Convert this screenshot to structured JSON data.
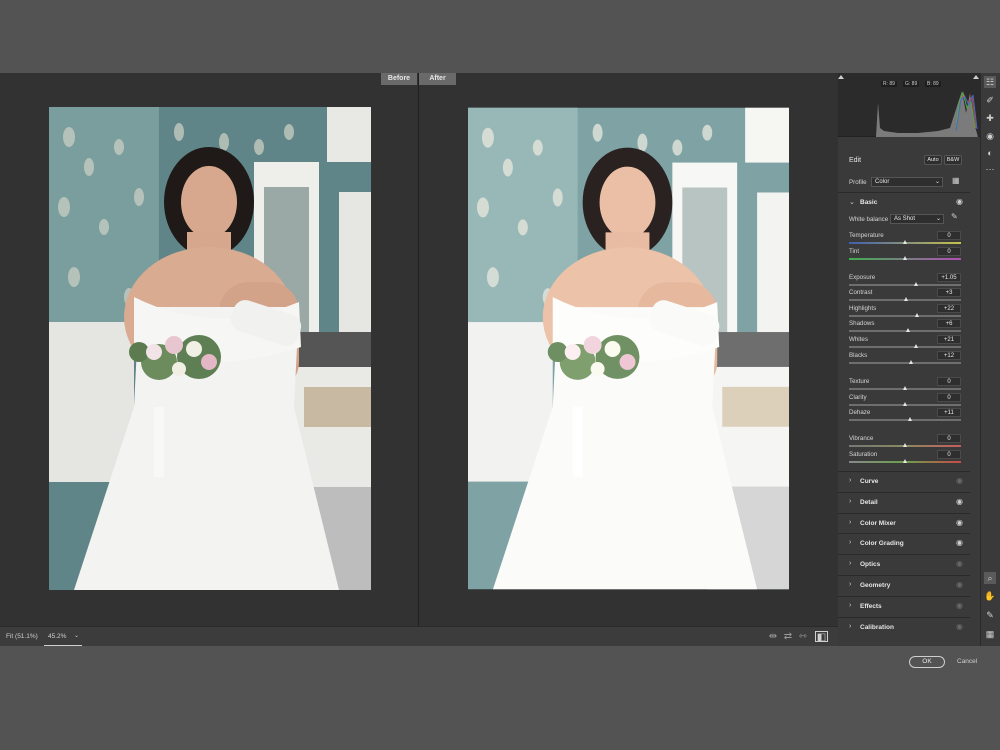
{
  "view": {
    "before_label": "Before",
    "after_label": "After"
  },
  "bottom_bar": {
    "fit_label": "Fit (51.1%)",
    "zoom_value": "45.2%"
  },
  "histogram": {
    "r": "R: 89",
    "g": "G: 89",
    "b": "B: 89"
  },
  "edit": {
    "title": "Edit",
    "auto_label": "Auto",
    "bw_label": "B&W",
    "profile_label": "Profile",
    "profile_value": "Color"
  },
  "basic": {
    "title": "Basic",
    "white_balance_label": "White balance",
    "white_balance_value": "As Shot",
    "sliders": [
      {
        "label": "Temperature",
        "value": "0",
        "position": 0.5,
        "gradient": "linear-gradient(90deg,#3f5fb0,#c9c24a)"
      },
      {
        "label": "Tint",
        "value": "0",
        "position": 0.5,
        "gradient": "linear-gradient(90deg,#3fae4f,#b04fb4)"
      },
      {
        "label": "Exposure",
        "value": "+1.05",
        "position": 0.6
      },
      {
        "label": "Contrast",
        "value": "+3",
        "position": 0.51
      },
      {
        "label": "Highlights",
        "value": "+22",
        "position": 0.61
      },
      {
        "label": "Shadows",
        "value": "+6",
        "position": 0.53
      },
      {
        "label": "Whites",
        "value": "+21",
        "position": 0.6
      },
      {
        "label": "Blacks",
        "value": "+12",
        "position": 0.56
      },
      {
        "label": "Texture",
        "value": "0",
        "position": 0.5
      },
      {
        "label": "Clarity",
        "value": "0",
        "position": 0.5
      },
      {
        "label": "Dehaze",
        "value": "+11",
        "position": 0.55
      },
      {
        "label": "Vibrance",
        "value": "0",
        "position": 0.5,
        "gradient": "linear-gradient(90deg,#777,#8a8a60,#c85c5c)"
      },
      {
        "label": "Saturation",
        "value": "0",
        "position": 0.5,
        "gradient": "linear-gradient(90deg,#888,#6aa04a,#c84a4a)"
      }
    ]
  },
  "sections": [
    {
      "name": "Curve"
    },
    {
      "name": "Detail"
    },
    {
      "name": "Color Mixer"
    },
    {
      "name": "Color Grading"
    },
    {
      "name": "Optics"
    },
    {
      "name": "Geometry"
    },
    {
      "name": "Effects"
    },
    {
      "name": "Calibration"
    }
  ],
  "footer": {
    "ok_label": "OK",
    "cancel_label": "Cancel"
  },
  "icons": {
    "tools": [
      "edit-sliders-icon",
      "brush-icon",
      "heal-icon",
      "red-eye-icon",
      "masking-icon",
      "more-icon",
      "zoom-icon",
      "hand-icon",
      "color-sampler-icon",
      "grid-icon"
    ]
  }
}
